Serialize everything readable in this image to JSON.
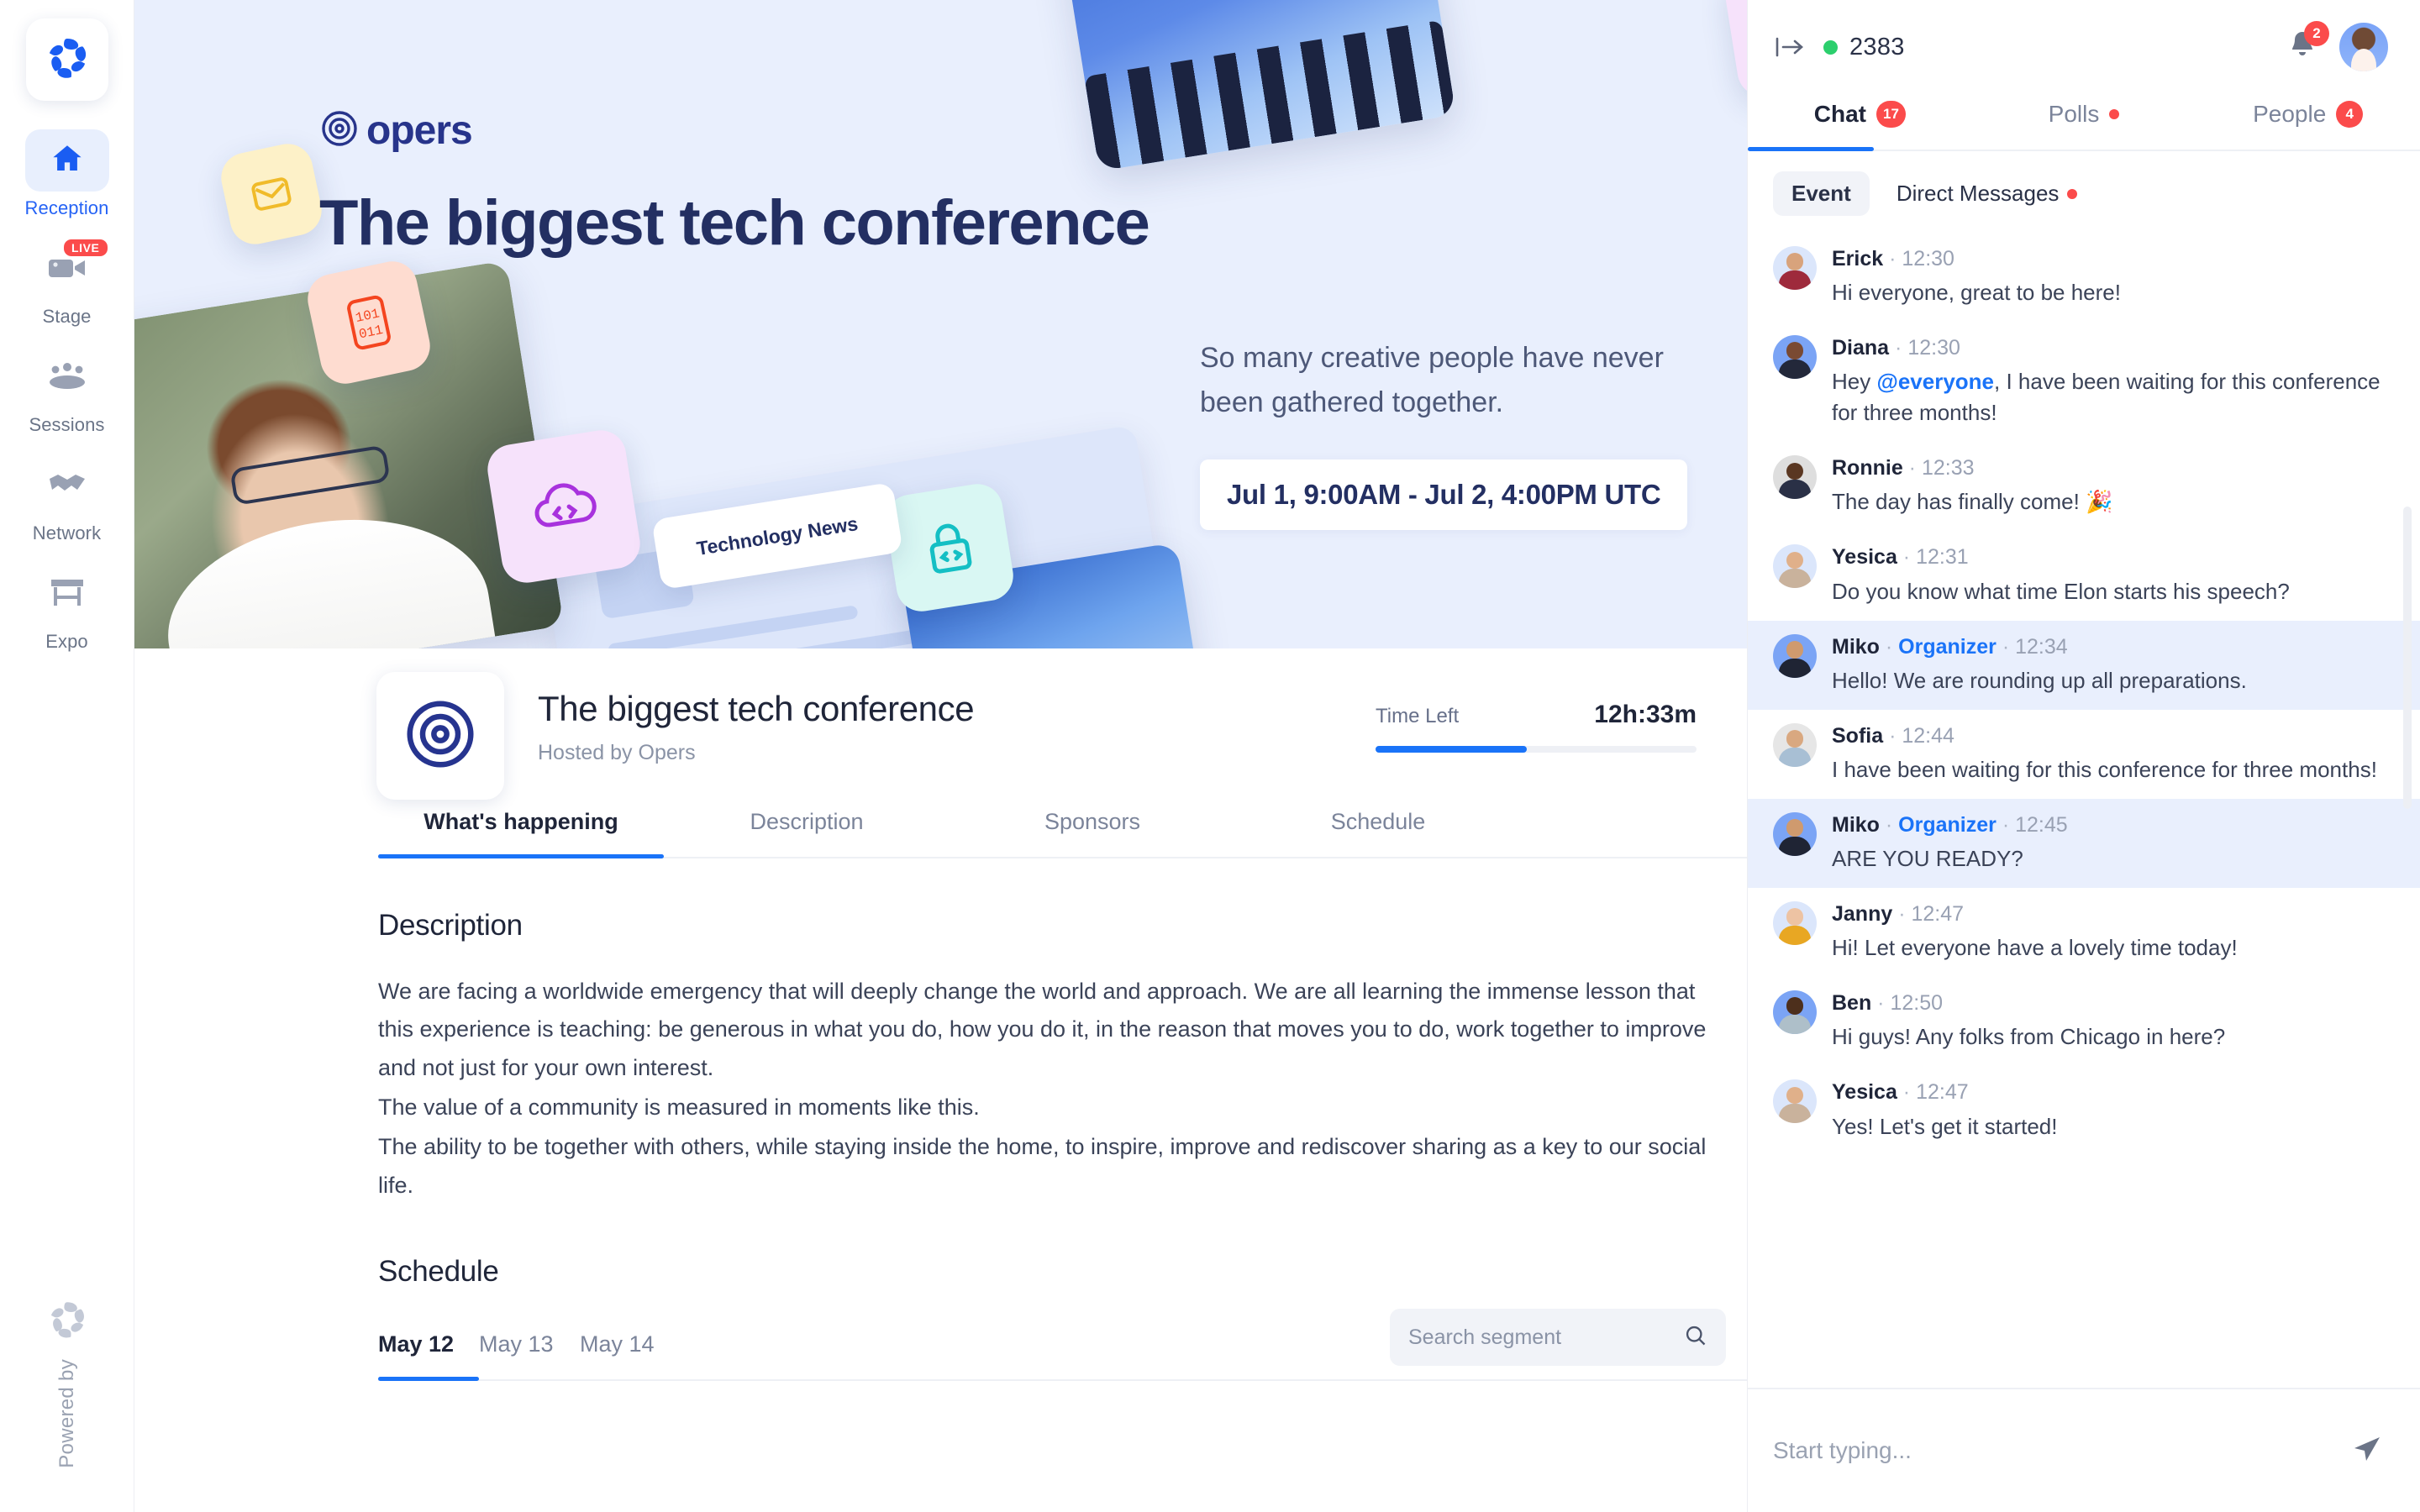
{
  "sidebar": {
    "brand_icon": "opers-logo-icon",
    "items": [
      {
        "label": "Reception",
        "icon": "home-icon",
        "active": true,
        "badge": ""
      },
      {
        "label": "Stage",
        "icon": "video-camera-icon",
        "active": false,
        "badge": "LIVE"
      },
      {
        "label": "Sessions",
        "icon": "people-group-icon",
        "active": false,
        "badge": ""
      },
      {
        "label": "Network",
        "icon": "handshake-icon",
        "active": false,
        "badge": ""
      },
      {
        "label": "Expo",
        "icon": "booth-icon",
        "active": false,
        "badge": ""
      }
    ],
    "powered_by": "Powered by"
  },
  "hero": {
    "logo_text": "opers",
    "title": "The biggest tech conference",
    "subtitle": "So many creative people have never been gathered together.",
    "date_badge": "Jul 1, 9:00AM - Jul 2, 4:00PM UTC",
    "news_pill": "Technology News"
  },
  "event": {
    "title": "The biggest tech conference",
    "host": "Hosted by Opers",
    "time_left_label": "Time Left",
    "time_left_value": "12h:33m",
    "time_left_percent": 47
  },
  "tabs": [
    {
      "label": "What's happening",
      "active": true
    },
    {
      "label": "Description",
      "active": false
    },
    {
      "label": "Sponsors",
      "active": false
    },
    {
      "label": "Schedule",
      "active": false
    }
  ],
  "description": {
    "heading": "Description",
    "paragraphs": [
      "We are facing a worldwide emergency that will deeply change the world and approach. We are all learning the immense lesson that this experience is teaching: be generous in what you do, how you do it, in the reason that moves you to do, work together to improve and not just for your own interest.",
      "The value of a community is measured in moments like this.",
      "The ability to be together with others, while staying inside the home, to inspire, improve and rediscover sharing as a key to our social life."
    ]
  },
  "schedule": {
    "heading": "Schedule",
    "days": [
      {
        "label": "May 12",
        "active": true
      },
      {
        "label": "May 13",
        "active": false
      },
      {
        "label": "May 14",
        "active": false
      }
    ],
    "search_placeholder": "Search segment",
    "search_value": "",
    "search_icon": "search-icon",
    "filter_icon": "filter-funnel-icon"
  },
  "chat_panel": {
    "collapse_icon": "collapse-panel-icon",
    "online_count": "2383",
    "notifications_badge": "2",
    "bell_icon": "bell-icon",
    "avatar_name": "user-avatar",
    "tabs": [
      {
        "label": "Chat",
        "badge": "17",
        "dot": false,
        "active": true
      },
      {
        "label": "Polls",
        "badge": "",
        "dot": true,
        "active": false
      },
      {
        "label": "People",
        "badge": "4",
        "dot": false,
        "active": false
      }
    ],
    "subtabs": [
      {
        "label": "Event",
        "dot": false,
        "active": true
      },
      {
        "label": "Direct Messages",
        "dot": true,
        "active": false
      }
    ],
    "messages": [
      {
        "name": "Erick",
        "role": "",
        "time": "12:30",
        "text": "Hi everyone, great to be here!",
        "highlight": false,
        "mention": "",
        "skin": "#d8a37c",
        "shirt": "#9e2a3c",
        "bg": "#dbe6fb"
      },
      {
        "name": "Diana",
        "role": "",
        "time": "12:30",
        "text": "Hey @everyone, I have been waiting for this conference for three months!",
        "highlight": false,
        "mention": "@everyone",
        "skin": "#7a4a32",
        "shirt": "#23283a",
        "bg": "#7ba4f5"
      },
      {
        "name": "Ronnie",
        "role": "",
        "time": "12:33",
        "text": "The day has finally come! 🎉",
        "highlight": false,
        "mention": "",
        "skin": "#5a3722",
        "shirt": "#2a3046",
        "bg": "#dedede"
      },
      {
        "name": "Yesica",
        "role": "",
        "time": "12:31",
        "text": "Do you know what time Elon starts his speech?",
        "highlight": false,
        "mention": "",
        "skin": "#e0b08a",
        "shirt": "#c9b29c",
        "bg": "#dbe6fb"
      },
      {
        "name": "Miko",
        "role": "Organizer",
        "time": "12:34",
        "text": "Hello! We are rounding up all preparations.",
        "highlight": true,
        "mention": "",
        "skin": "#cf9a6e",
        "shirt": "#1f2434",
        "bg": "#7ba4f5"
      },
      {
        "name": "Sofia",
        "role": "",
        "time": "12:44",
        "text": "I have been waiting for this conference for three months!",
        "highlight": false,
        "mention": "",
        "skin": "#d9a880",
        "shirt": "#a8bfd4",
        "bg": "#e6e6e6"
      },
      {
        "name": "Miko",
        "role": "Organizer",
        "time": "12:45",
        "text": "ARE YOU READY?",
        "highlight": true,
        "mention": "",
        "skin": "#cf9a6e",
        "shirt": "#1f2434",
        "bg": "#7ba4f5"
      },
      {
        "name": "Janny",
        "role": "",
        "time": "12:47",
        "text": "Hi! Let everyone have a lovely time today!",
        "highlight": false,
        "mention": "",
        "skin": "#edc3a3",
        "shirt": "#e8a723",
        "bg": "#dbe6fb"
      },
      {
        "name": "Ben",
        "role": "",
        "time": "12:50",
        "text": "Hi guys! Any folks from Chicago in here?",
        "highlight": false,
        "mention": "",
        "skin": "#4d2f1c",
        "shirt": "#aebfc9",
        "bg": "#7ba4f5"
      },
      {
        "name": "Yesica",
        "role": "",
        "time": "12:47",
        "text": "Yes! Let's get it started!",
        "highlight": false,
        "mention": "",
        "skin": "#e0b08a",
        "shirt": "#c9b29c",
        "bg": "#dbe6fb"
      }
    ],
    "composer_placeholder": "Start typing...",
    "composer_value": "",
    "send_icon": "send-paper-plane-icon"
  },
  "colors": {
    "accent_blue": "#1a73f8",
    "brand_navy": "#232f62",
    "alert_red": "#fb4b4b",
    "online_green": "#2ccf6d",
    "hero_bg": "#e9effd",
    "highlight_bg": "#e9effd"
  }
}
